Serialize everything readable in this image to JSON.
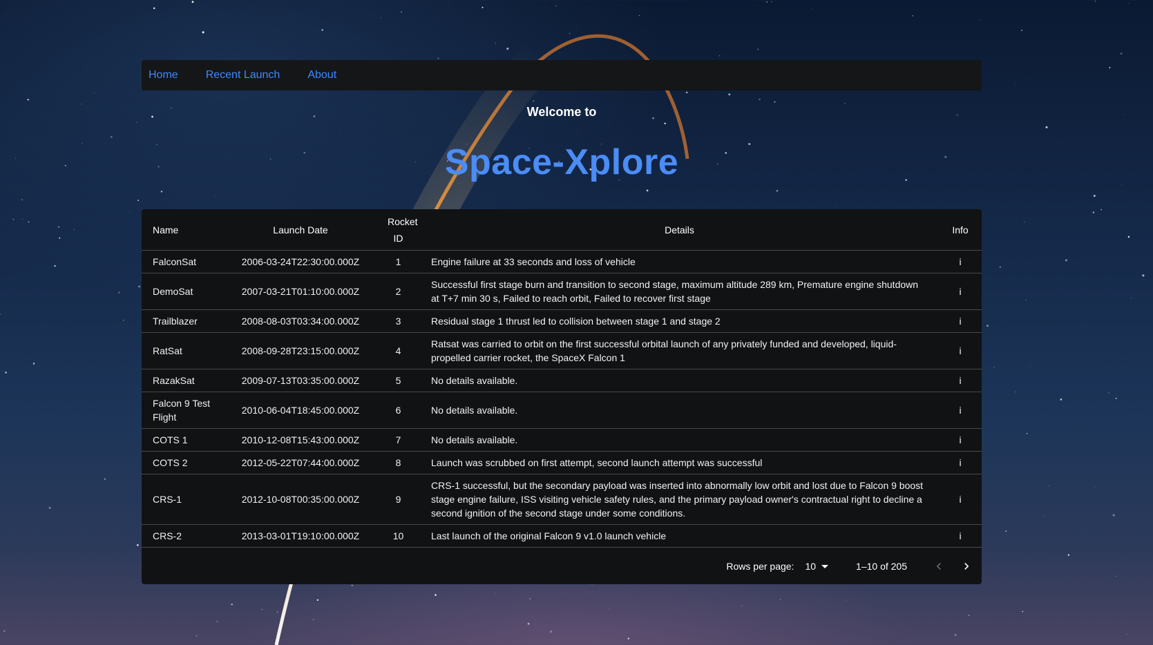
{
  "nav": {
    "links": [
      "Home",
      "Recent Launch",
      "About"
    ]
  },
  "hero": {
    "welcome": "Welcome to",
    "brand": "Space-Xplore"
  },
  "table": {
    "columns": {
      "name": "Name",
      "launch_date": "Launch Date",
      "rocket_id": "Rocket ID",
      "details": "Details",
      "info": "Info"
    },
    "rows": [
      {
        "name": "FalconSat",
        "date": "2006-03-24T22:30:00.000Z",
        "rocket": "1",
        "details": "Engine failure at 33 seconds and loss of vehicle",
        "info": "i"
      },
      {
        "name": "DemoSat",
        "date": "2007-03-21T01:10:00.000Z",
        "rocket": "2",
        "details": "Successful first stage burn and transition to second stage, maximum altitude 289 km, Premature engine shutdown at T+7 min 30 s, Failed to reach orbit, Failed to recover first stage",
        "info": "i"
      },
      {
        "name": "Trailblazer",
        "date": "2008-08-03T03:34:00.000Z",
        "rocket": "3",
        "details": "Residual stage 1 thrust led to collision between stage 1 and stage 2",
        "info": "i"
      },
      {
        "name": "RatSat",
        "date": "2008-09-28T23:15:00.000Z",
        "rocket": "4",
        "details": "Ratsat was carried to orbit on the first successful orbital launch of any privately funded and developed, liquid-propelled carrier rocket, the SpaceX Falcon 1",
        "info": "i"
      },
      {
        "name": "RazakSat",
        "date": "2009-07-13T03:35:00.000Z",
        "rocket": "5",
        "details": "No details available.",
        "info": "i"
      },
      {
        "name": "Falcon 9 Test Flight",
        "date": "2010-06-04T18:45:00.000Z",
        "rocket": "6",
        "details": "No details available.",
        "info": "i"
      },
      {
        "name": "COTS 1",
        "date": "2010-12-08T15:43:00.000Z",
        "rocket": "7",
        "details": "No details available.",
        "info": "i"
      },
      {
        "name": "COTS 2",
        "date": "2012-05-22T07:44:00.000Z",
        "rocket": "8",
        "details": "Launch was scrubbed on first attempt, second launch attempt was successful",
        "info": "i"
      },
      {
        "name": "CRS-1",
        "date": "2012-10-08T00:35:00.000Z",
        "rocket": "9",
        "details": "CRS-1 successful, but the secondary payload was inserted into abnormally low orbit and lost due to Falcon 9 boost stage engine failure, ISS visiting vehicle safety rules, and the primary payload owner's contractual right to decline a second ignition of the second stage under some conditions.",
        "info": "i"
      },
      {
        "name": "CRS-2",
        "date": "2013-03-01T19:10:00.000Z",
        "rocket": "10",
        "details": "Last launch of the original Falcon 9 v1.0 launch vehicle",
        "info": "i"
      }
    ]
  },
  "pagination": {
    "rows_per_page_label": "Rows per page:",
    "rows_per_page_value": "10",
    "range_text": "1–10 of 205",
    "prev_icon": "chevron-left-icon",
    "next_icon": "chevron-right-icon"
  },
  "colors": {
    "nav_link": "#3f88ff",
    "brand": "#4b8cf5",
    "panel": "#111214"
  }
}
